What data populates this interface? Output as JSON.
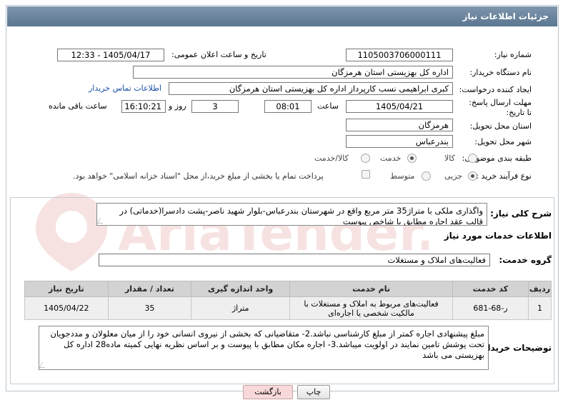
{
  "header": {
    "title": "جزئیات اطلاعات نیاز"
  },
  "fields": {
    "need_number_label": "شماره نیاز:",
    "need_number": "1105003706000111",
    "announce_label": "تاریخ و ساعت اعلان عمومی:",
    "announce_value": "1405/04/17 - 12:33",
    "buyer_org_label": "نام دستگاه خریدار:",
    "buyer_org": "اداره کل بهزیستی استان هرمزگان",
    "creator_label": "ایجاد کننده درخواست:",
    "creator": "کبری  ابراهیمی نسب کارپرداز اداره کل بهزیستی استان هرمزگان",
    "contact_link": "اطلاعات تماس خریدار",
    "deadline_label": "مهلت ارسال پاسخ: تا تاریخ:",
    "deadline_date": "1405/04/21",
    "time_label": "ساعت",
    "deadline_time": "08:01",
    "days_value": "3",
    "days_label": "روز و",
    "remaining_time": "16:10:21",
    "remaining_label": "ساعت باقی مانده",
    "province_label": "استان محل تحویل:",
    "province": "هرمزگان",
    "city_label": "شهر محل تحویل:",
    "city": "بندرعباس",
    "category_label": "طبقه بندی موضوعی:",
    "category_options": [
      "کالا",
      "خدمت",
      "کالا/خدمت"
    ],
    "process_label": "نوع فرآیند خرید :",
    "process_options": [
      "جزیی",
      "متوسط"
    ],
    "payment_note": "پرداخت تمام یا بخشی از مبلغ خرید،از محل \"اسناد خزانه اسلامی\" خواهد بود."
  },
  "description": {
    "label": "شرح کلی نیاز:",
    "text": "واگذاری ملکی با متراژ35 متر مربع واقع در شهرستان بندرعباس-بلوار شهید ناصر-پشت دادسرا(خدماتی) در قالب عقد اجاره مطابق با شاخص پیوست"
  },
  "services": {
    "section_title": "اطلاعات خدمات مورد نیاز",
    "group_label": "گروه خدمت:",
    "group_value": "فعالیت‌های  املاک و مستغلات",
    "columns": [
      "ردیف",
      "کد خدمت",
      "نام خدمت",
      "واحد اندازه گیری",
      "تعداد / مقدار",
      "تاریخ نیاز"
    ],
    "rows": [
      [
        "1",
        "ر-68-681",
        "فعالیت‌های مربوط به املاک و مستغلات با مالکیت شخصی یا اجاره‌ای",
        "متراژ",
        "35",
        "1405/04/22"
      ]
    ]
  },
  "buyer_notes": {
    "label": "توضیحات خریدار:",
    "text": "مبلغ پیشنهادی  اجاره کمتر از مبلغ کارشناسی نباشد.2- متقاضیانی که بخشی از نیروی انسانی خود را از میان معلولان و مددجویان تحت پوشش تامین نمایند در اولویت میباشد.3-  اجاره مکان  مطابق با پیوست و بر اساس نظریه نهایی کمیته ماده28 اداره کل بهزیستی می باشد"
  },
  "buttons": {
    "print": "چاپ",
    "back": "بازگشت"
  },
  "watermark": {
    "text": "AriaTender.net"
  },
  "colors": {
    "header_bg": "#6b839c",
    "link": "#1a4fa8",
    "back_btn": "#f7d9d9"
  }
}
